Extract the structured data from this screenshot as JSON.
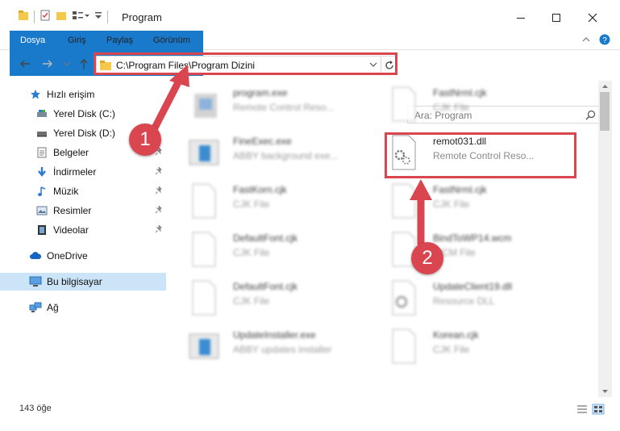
{
  "window": {
    "title": "Program"
  },
  "ribbon": {
    "tabs": [
      "Dosya",
      "Giriş",
      "Paylaş",
      "Görünüm"
    ]
  },
  "address": {
    "path": "C:\\Program Files\\Program Dizini"
  },
  "search": {
    "placeholder": "Ara: Program"
  },
  "sidebar": {
    "items": [
      {
        "label": "Hızlı erişim",
        "icon": "star-icon"
      },
      {
        "label": "Yerel Disk (C:)",
        "icon": "drive-icon"
      },
      {
        "label": "Yerel Disk (D:)",
        "icon": "drive-icon"
      },
      {
        "label": "Belgeler",
        "icon": "document-icon"
      },
      {
        "label": "İndirmeler",
        "icon": "download-icon"
      },
      {
        "label": "Müzik",
        "icon": "music-icon"
      },
      {
        "label": "Resimler",
        "icon": "pictures-icon"
      },
      {
        "label": "Videolar",
        "icon": "video-icon"
      },
      {
        "label": "OneDrive",
        "icon": "cloud-icon"
      },
      {
        "label": "Bu bilgisayar",
        "icon": "computer-icon"
      },
      {
        "label": "Ağ",
        "icon": "network-icon"
      }
    ]
  },
  "files": {
    "left": [
      {
        "name": "program.exe",
        "desc": "Remote Control Reso...",
        "icon": "exe-icon"
      },
      {
        "name": "FineExec.exe",
        "desc": "ABBY background exe...",
        "icon": "exe-icon"
      },
      {
        "name": "FastKorn.cjk",
        "desc": "CJK File",
        "icon": "file-icon"
      },
      {
        "name": "DefaultFont.cjk",
        "desc": "CJK File",
        "icon": "file-icon"
      },
      {
        "name": "DefaultFont.cjk",
        "desc": "CJK File",
        "icon": "file-icon"
      },
      {
        "name": "UpdateInstaller.exe",
        "desc": "ABBY updates installer",
        "icon": "exe-icon"
      }
    ],
    "right": [
      {
        "name": "FastNrml.cjk",
        "desc": "CJK File",
        "icon": "file-icon"
      },
      {
        "name": "remot031.dll",
        "desc": "Remote Control Reso...",
        "icon": "dll-icon"
      },
      {
        "name": "FastNrml.cjk",
        "desc": "CJK File",
        "icon": "file-icon"
      },
      {
        "name": "BindToWP14.wcm",
        "desc": "WCM File",
        "icon": "file-icon"
      },
      {
        "name": "UpdateClient19.dll",
        "desc": "Resource DLL",
        "icon": "dll-icon"
      },
      {
        "name": "Korean.cjk",
        "desc": "CJK File",
        "icon": "file-icon"
      }
    ]
  },
  "status": {
    "count": "143 öğe"
  },
  "annotations": {
    "step1": "1",
    "step2": "2"
  },
  "colors": {
    "accent": "#1979ca",
    "highlight": "#d9464f",
    "selected": "#cce4f7"
  }
}
